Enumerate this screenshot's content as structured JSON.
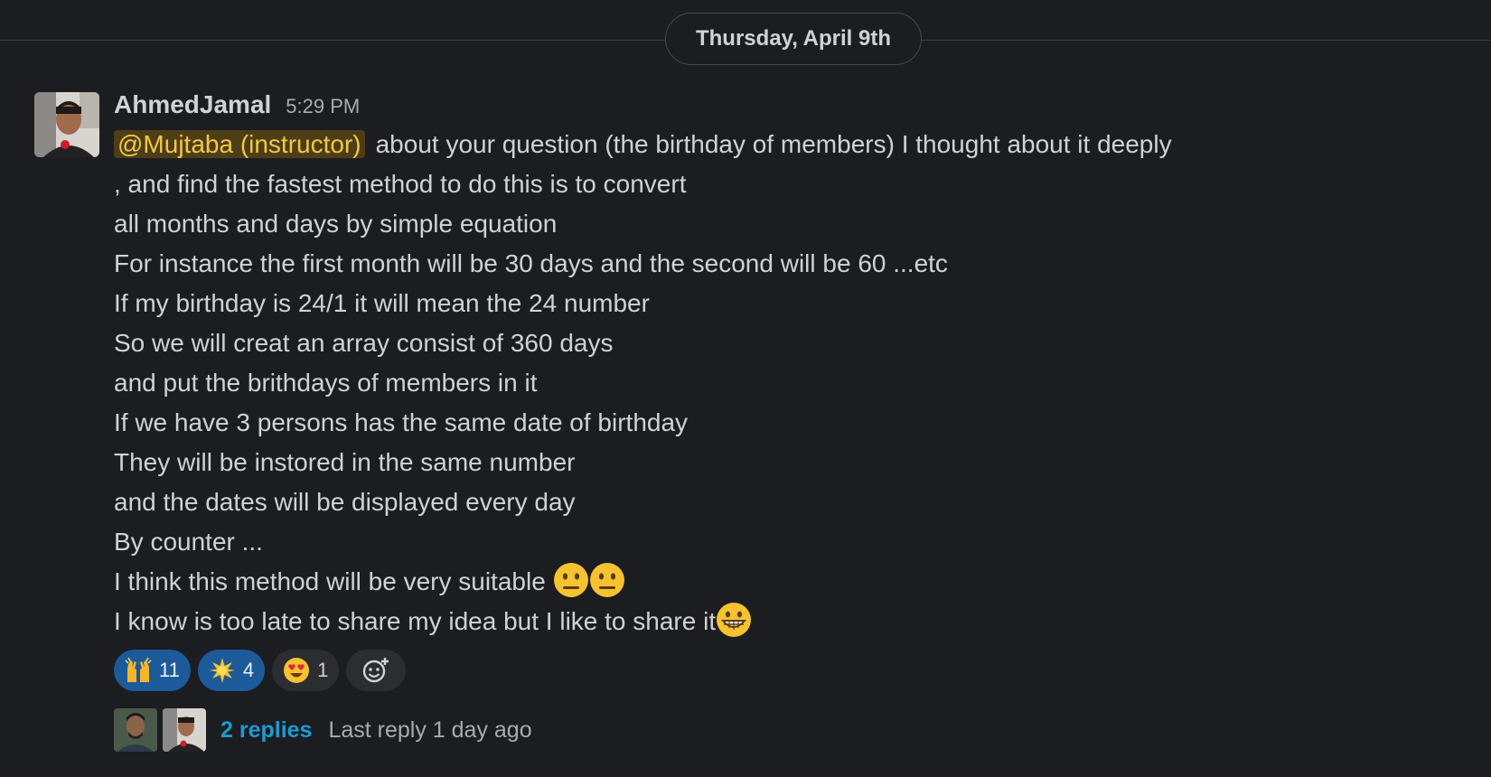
{
  "divider": {
    "date_label": "Thursday, April 9th"
  },
  "message": {
    "sender": "AhmedJamal",
    "timestamp": "5:29 PM",
    "mention": "@Mujtaba (instructor)",
    "first_line_rest": "about your question (the birthday of members) I thought about it deeply",
    "lines": [
      ", and find the fastest method to do this is to convert",
      "all months and days by simple equation",
      "For instance the first month will be 30 days and the second will be 60 ...etc",
      "If my birthday is 24/1 it will mean the 24 number",
      "So we will creat an array consist of 360 days",
      "and put the brithdays of members in it",
      "If we have 3 persons has the same date of birthday",
      "They will be instored in the same number",
      "and the dates will be displayed every day",
      "By counter ..."
    ],
    "line_suitable": "I think this method will be very suitable",
    "line_late": "I know is too late to share my idea but I like to share it",
    "emoji_names": [
      "neutral-face",
      "neutral-face",
      "grinning-face"
    ]
  },
  "reactions": [
    {
      "emoji": "raised-hands",
      "count": "11",
      "active": true
    },
    {
      "emoji": "sun-star",
      "count": "4",
      "active": true
    },
    {
      "emoji": "heart-eyes",
      "count": "1",
      "active": false
    }
  ],
  "thread": {
    "reply_count": "2 replies",
    "last_reply": "Last reply 1 day ago"
  },
  "colors": {
    "background": "#1b1d21",
    "text": "#d1d2d3",
    "mention_bg": "#4d3e18",
    "mention_text": "#f2c744",
    "link": "#1d9bd1",
    "reaction_active": "#1d5a99"
  }
}
